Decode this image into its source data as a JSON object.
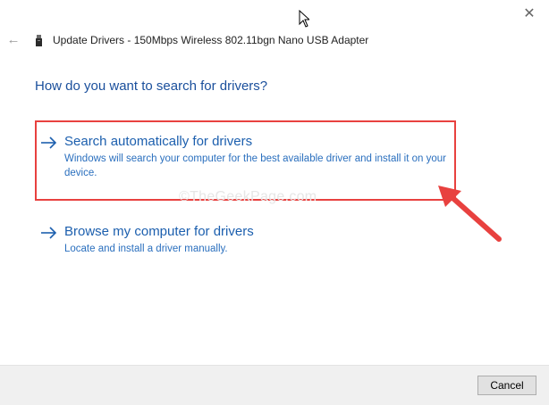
{
  "window": {
    "title": "Update Drivers - 150Mbps Wireless 802.11bgn Nano USB Adapter",
    "close_symbol": "✕",
    "back_symbol": "←",
    "icons": {
      "close": "close-icon",
      "back": "back-arrow-icon",
      "device": "usb-adapter-icon",
      "cursor": "mouse-cursor-icon"
    }
  },
  "main": {
    "heading": "How do you want to search for drivers?",
    "options": [
      {
        "title": "Search automatically for drivers",
        "description": "Windows will search your computer for the best available driver and install it on your device.",
        "icon": "right-arrow-icon"
      },
      {
        "title": "Browse my computer for drivers",
        "description": "Locate and install a driver manually.",
        "icon": "right-arrow-icon"
      }
    ],
    "watermark": "©TheGeekPage.com"
  },
  "annotations": {
    "highlight_color": "#e8413f",
    "pointer_icon": "red-pointer-arrow"
  },
  "footer": {
    "cancel_label": "Cancel"
  },
  "colors": {
    "heading": "#1a4f9c",
    "link": "#1c5fae",
    "description": "#2a6fbe",
    "footer_bg": "#f0f0f0"
  }
}
